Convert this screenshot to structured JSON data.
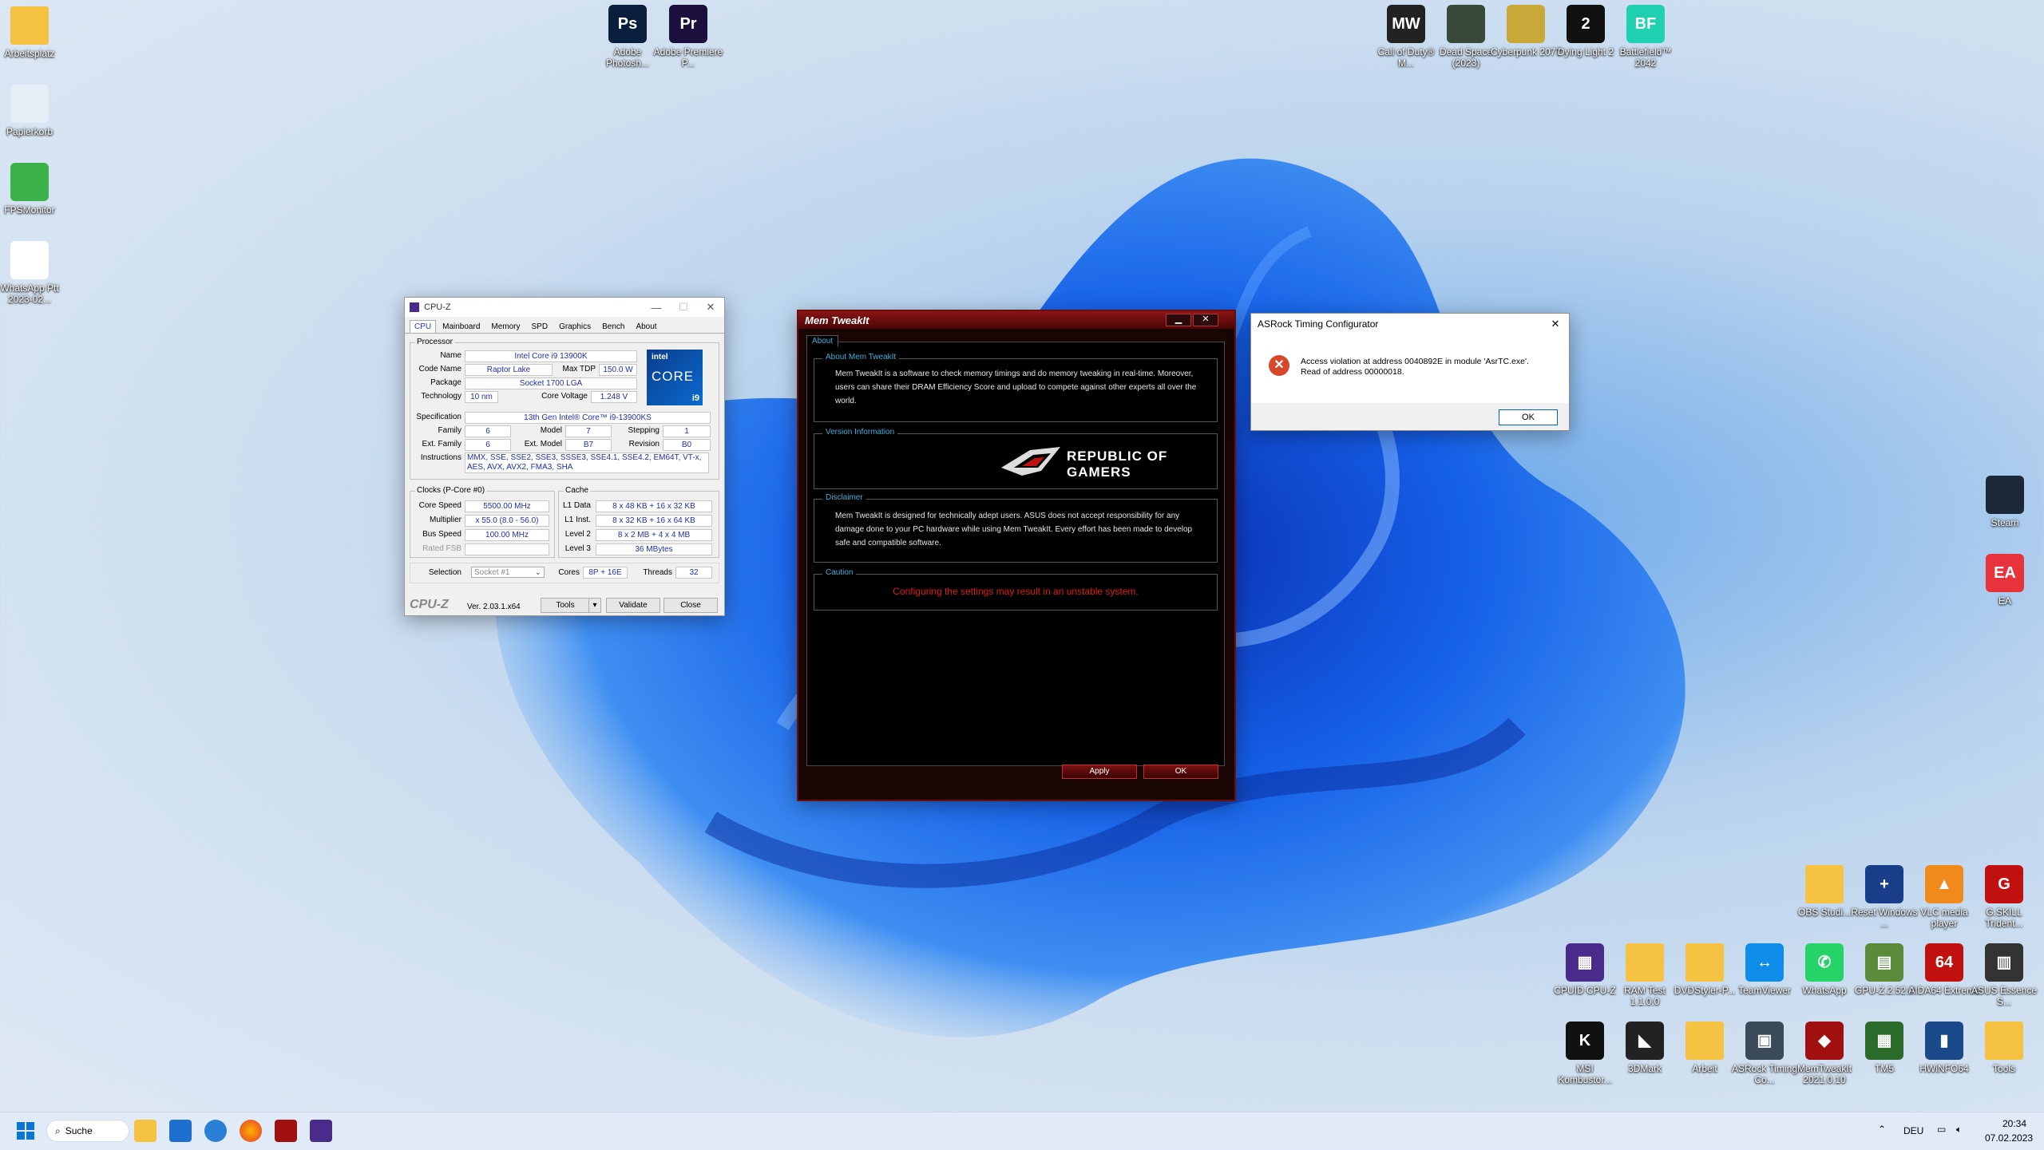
{
  "desktop": {
    "left_icons": [
      {
        "label": "Arbeitsplatz",
        "icon": "folder-icon",
        "color": "#f5c242"
      },
      {
        "label": "Papierkorb",
        "icon": "recycle-bin-icon",
        "color": "#e8eef5"
      },
      {
        "label": "FPSMonitor",
        "icon": "fpsmonitor-icon",
        "color": "#3cb34a"
      },
      {
        "label": "WhatsApp Ptt 2023-02...",
        "icon": "audio-file-icon",
        "color": "#ffffff"
      }
    ],
    "top_icons": [
      {
        "label": "Adobe Photosh...",
        "icon": "photoshop-icon",
        "color": "#0a1f3d",
        "glyph": "Ps"
      },
      {
        "label": "Adobe Premiere P...",
        "icon": "premiere-icon",
        "color": "#1a0f3d",
        "glyph": "Pr"
      }
    ],
    "game_icons": [
      {
        "label": "Call of Duty® M...",
        "icon": "cod-icon",
        "color": "#222222",
        "glyph": "MW"
      },
      {
        "label": "Dead Space (2023)",
        "icon": "dead-space-icon",
        "color": "#3a4a3a",
        "glyph": ""
      },
      {
        "label": "Cyberpunk 2077",
        "icon": "cyberpunk-icon",
        "color": "#c9a83a",
        "glyph": ""
      },
      {
        "label": "Dying Light 2",
        "icon": "dying-light-icon",
        "color": "#111111",
        "glyph": "2"
      },
      {
        "label": "Battlefield™ 2042",
        "icon": "battlefield-icon",
        "color": "#1fd1b0",
        "glyph": "BF"
      }
    ],
    "right_icons": [
      {
        "label": "Steam",
        "icon": "steam-icon",
        "color": "#1b2838",
        "glyph": ""
      },
      {
        "label": "EA",
        "icon": "ea-icon",
        "color": "#e8323c",
        "glyph": "EA"
      }
    ],
    "bottom_row1": [
      {
        "label": "OBS Studi...",
        "icon": "folder-icon",
        "color": "#f5c242",
        "glyph": ""
      },
      {
        "label": "Reset Windows ...",
        "icon": "reset-icon",
        "color": "#1a3d8a",
        "glyph": "+"
      },
      {
        "label": "VLC media player",
        "icon": "vlc-icon",
        "color": "#f08a1c",
        "glyph": "▲"
      },
      {
        "label": "G.SKILL Trident...",
        "icon": "gskill-icon",
        "color": "#c01010",
        "glyph": "G"
      }
    ],
    "bottom_row2": [
      {
        "label": "CPUID CPU-Z",
        "icon": "cpuz-icon",
        "color": "#4a2a8a",
        "glyph": "▦"
      },
      {
        "label": "RAM Test 1.1.0.0",
        "icon": "folder-icon",
        "color": "#f5c242",
        "glyph": ""
      },
      {
        "label": "DVDStyler-P...",
        "icon": "folder-icon",
        "color": "#f5c242",
        "glyph": ""
      },
      {
        "label": "TeamViewer",
        "icon": "teamviewer-icon",
        "color": "#0e8ee9",
        "glyph": "↔"
      },
      {
        "label": "WhatsApp",
        "icon": "whatsapp-icon",
        "color": "#25d366",
        "glyph": "✆"
      },
      {
        "label": "GPU-Z.2.52.0",
        "icon": "gpuz-icon",
        "color": "#5a8a3a",
        "glyph": "▤"
      },
      {
        "label": "AIDA64 Extreme",
        "icon": "aida64-icon",
        "color": "#c01010",
        "glyph": "64"
      },
      {
        "label": "ASUS Essence S...",
        "icon": "asus-icon",
        "color": "#333333",
        "glyph": "▥"
      }
    ],
    "bottom_row3": [
      {
        "label": "MSI Kombustor...",
        "icon": "kombustor-icon",
        "color": "#111111",
        "glyph": "K"
      },
      {
        "label": "3DMark",
        "icon": "3dmark-icon",
        "color": "#222222",
        "glyph": "◣"
      },
      {
        "label": "Arbeit",
        "icon": "folder-icon",
        "color": "#f5c242",
        "glyph": ""
      },
      {
        "label": "ASRock Timing Co...",
        "icon": "asrock-icon",
        "color": "#3a4a5a",
        "glyph": "▣"
      },
      {
        "label": "MemTweakIt 2021.0.10",
        "icon": "memtweakit-icon",
        "color": "#a01010",
        "glyph": "◆"
      },
      {
        "label": "TM5",
        "icon": "tm5-icon",
        "color": "#2a6a2a",
        "glyph": "▦"
      },
      {
        "label": "HWiNFO64",
        "icon": "hwinfo-icon",
        "color": "#1a4a8a",
        "glyph": "▮"
      },
      {
        "label": "Tools",
        "icon": "folder-icon",
        "color": "#f5c242",
        "glyph": ""
      }
    ]
  },
  "cpuz": {
    "title": "CPU-Z",
    "tabs": [
      "CPU",
      "Mainboard",
      "Memory",
      "SPD",
      "Graphics",
      "Bench",
      "About"
    ],
    "processor_caption": "Processor",
    "name_label": "Name",
    "name": "Intel Core i9 13900K",
    "codename_label": "Code Name",
    "codename": "Raptor Lake",
    "maxtdp_label": "Max TDP",
    "maxtdp": "150.0 W",
    "package_label": "Package",
    "package": "Socket 1700 LGA",
    "technology_label": "Technology",
    "technology": "10 nm",
    "corevoltage_label": "Core Voltage",
    "corevoltage": "1.248 V",
    "spec_label": "Specification",
    "spec": "13th Gen Intel® Core™ i9-13900KS",
    "family_label": "Family",
    "family": "6",
    "model_label": "Model",
    "model": "7",
    "stepping_label": "Stepping",
    "stepping": "1",
    "extfamily_label": "Ext. Family",
    "extfamily": "6",
    "extmodel_label": "Ext. Model",
    "extmodel": "B7",
    "revision_label": "Revision",
    "revision": "B0",
    "instructions_label": "Instructions",
    "instructions": "MMX, SSE, SSE2, SSE3, SSSE3, SSE4.1, SSE4.2, EM64T, VT-x, AES, AVX, AVX2, FMA3, SHA",
    "logo_top": "intel",
    "logo_main": "CORE",
    "logo_badge": "i9",
    "clocks_caption": "Clocks (P-Core #0)",
    "corespeed_label": "Core Speed",
    "corespeed": "5500.00 MHz",
    "multiplier_label": "Multiplier",
    "multiplier": "x 55.0 (8.0 - 56.0)",
    "busspeed_label": "Bus Speed",
    "busspeed": "100.00 MHz",
    "ratedfsb_label": "Rated FSB",
    "ratedfsb": "",
    "cache_caption": "Cache",
    "l1data_label": "L1 Data",
    "l1data": "8 x 48 KB + 16 x 32 KB",
    "l1inst_label": "L1 Inst.",
    "l1inst": "8 x 32 KB + 16 x 64 KB",
    "level2_label": "Level 2",
    "level2": "8 x 2 MB + 4 x 4 MB",
    "level3_label": "Level 3",
    "level3": "36 MBytes",
    "selection_label": "Selection",
    "selection": "Socket #1",
    "cores_label": "Cores",
    "cores": "8P + 16E",
    "threads_label": "Threads",
    "threads": "32",
    "brand": "CPU-Z",
    "version": "Ver. 2.03.1.x64",
    "tools_label": "Tools",
    "validate_label": "Validate",
    "close_label": "Close"
  },
  "memtweakit": {
    "title": "Mem TweakIt",
    "tab": "About",
    "about_caption": "About Mem TweakIt",
    "about_text": "Mem TweakIt is a software to check memory timings and do memory tweaking in real-time. Moreover, users can share their DRAM Efficiency Score and upload to compete against other experts all over the world.",
    "version_caption": "Version Information",
    "rog_line1": "REPUBLIC OF",
    "rog_line2": "GAMERS",
    "disclaimer_caption": "Disclaimer",
    "disclaimer_text": "Mem TweakIt is designed for technically adept users. ASUS does not accept responsibility for any damage done to your PC hardware while using Mem TweakIt. Every effort has been made to develop safe and compatible software.",
    "caution_caption": "Caution",
    "caution_text": "Configuring the settings may result in an unstable system.",
    "apply_label": "Apply",
    "ok_label": "OK"
  },
  "asrock": {
    "title": "ASRock Timing Configurator",
    "line1": "Access violation at address 0040892E in module 'AsrTC.exe'.",
    "line2": "Read of address 00000018.",
    "ok_label": "OK"
  },
  "taskbar": {
    "search_label": "Suche",
    "language": "DEU",
    "time": "20:34",
    "date": "07.02.2023",
    "apps": [
      "start-icon",
      "search-icon",
      "file-explorer-icon",
      "store-icon",
      "refresh-icon",
      "firefox-icon",
      "memtweakit-icon",
      "cpuz-icon"
    ]
  }
}
